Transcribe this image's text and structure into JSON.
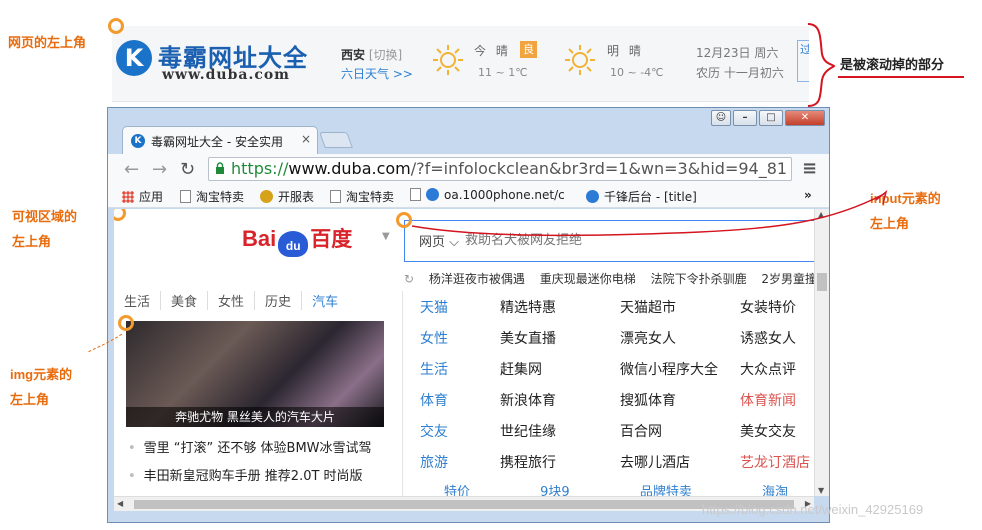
{
  "annotations": {
    "page_top_left": "网页的左上角",
    "scrolled_part": "是被滚动掉的部分",
    "viewport_top_left_1": "可视区域的",
    "viewport_top_left_2": "左上角",
    "input_top_left_1": "input元素的",
    "input_top_left_2": "左上角",
    "img_top_left_1": "img元素的",
    "img_top_left_2": "左上角"
  },
  "duba": {
    "logo_letter": "K",
    "title": "毒霸网址大全",
    "url_text": "www.duba.com",
    "city": "西安",
    "switch": "[切换]",
    "six_day": "六日天气 >>",
    "today_label": "今 晴",
    "today_aq": "良",
    "today_temp": "11 ~ 1℃",
    "tomorrow_label": "明 晴",
    "tomorrow_temp": "10 ~ -4℃",
    "date": "12月23日  周六",
    "lunar": "农历 十一月初六",
    "edge_text": "过"
  },
  "browser": {
    "tab_icon": "K",
    "tab_title": "毒霸网址大全 - 安全实用",
    "tab_close": "×",
    "url_scheme": "https://",
    "url_host": "www.duba.com",
    "url_rest": "/?f=infolockclean&br3rd=1&wn=3&hid=94_81",
    "bookmarks": [
      "应用",
      "淘宝特卖",
      "开服表",
      "淘宝特卖",
      "oa.1000phone.net/c",
      "千锋后台 - [title]"
    ],
    "bookmarks_more": "»"
  },
  "baidu": {
    "logo_bai": "Bai",
    "logo_du": "du",
    "logo_cn": "百度",
    "search_type": "网页 ⌵",
    "search_placeholder": "救助名犬被网友拒绝",
    "hot": [
      "杨洋逛夜市被偶遇",
      "重庆现最迷你电梯",
      "法院下令扑杀驯鹿",
      "2岁男童撞"
    ]
  },
  "left_panel": {
    "tabs": [
      "生活",
      "美食",
      "女性",
      "历史",
      "汽车"
    ],
    "photo_caption": "奔驰尤物 黑丝美人的汽车大片",
    "news": [
      "雪里 “打滚” 还不够 体验BMW冰雪试驾",
      "丰田新皇冠购车手册 推荐2.0T 时尚版"
    ]
  },
  "site_grid": [
    [
      "天猫",
      "精选特惠",
      "天猫超市",
      "女装特价"
    ],
    [
      "女性",
      "美女直播",
      "漂亮女人",
      "诱惑女人"
    ],
    [
      "生活",
      "赶集网",
      "微信小程序大全",
      "大众点评"
    ],
    [
      "体育",
      "新浪体育",
      "搜狐体育",
      "体育新闻"
    ],
    [
      "交友",
      "世纪佳缘",
      "百合网",
      "美女交友"
    ],
    [
      "旅游",
      "携程旅行",
      "去哪儿酒店",
      "艺龙订酒店"
    ]
  ],
  "bottom_links": [
    "特价",
    "9块9",
    "品牌特卖",
    "海淘"
  ],
  "watermark": "https://blog.csdn.net/weixin_42925169",
  "colors": {
    "annotation": "#e86b0c",
    "red_arrow": "#d4141f",
    "link_blue": "#2f7fd0",
    "accent_red": "#d9534f"
  }
}
